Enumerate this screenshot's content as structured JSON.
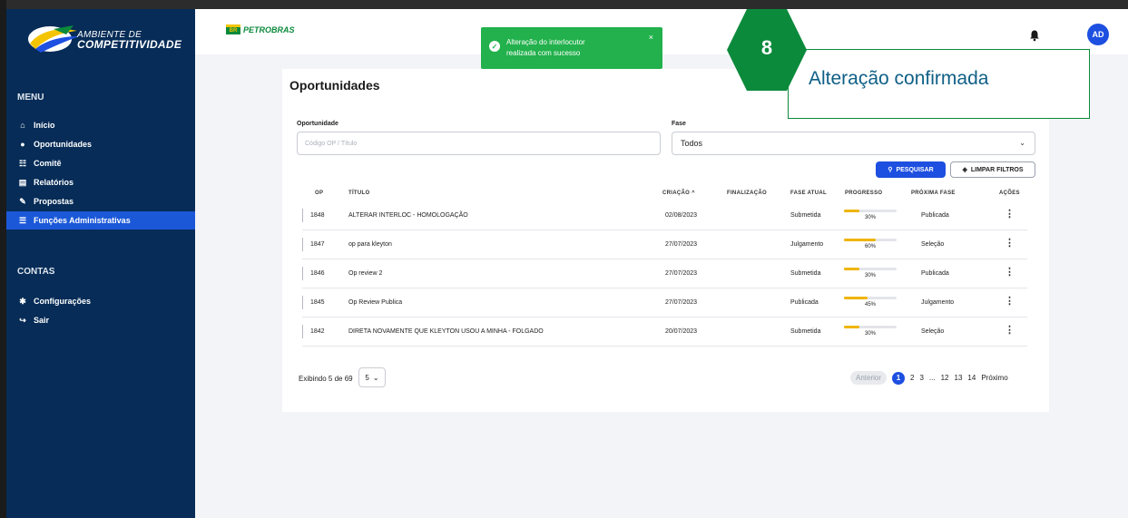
{
  "brand": {
    "line1": "AMBIENTE DE",
    "line2": "COMPETITIVIDADE"
  },
  "sidebar": {
    "menu_title": "MENU",
    "items": [
      {
        "icon": "home-icon",
        "glyph": "⌂",
        "label": "Início"
      },
      {
        "icon": "lightbulb-icon",
        "glyph": "●",
        "label": "Oportunidades"
      },
      {
        "icon": "committee-icon",
        "glyph": "☷",
        "label": "Comitê"
      },
      {
        "icon": "file-icon",
        "glyph": "▤",
        "label": "Relatórios"
      },
      {
        "icon": "proposal-icon",
        "glyph": "✎",
        "label": "Propostas"
      },
      {
        "icon": "list-icon",
        "glyph": "☰",
        "label": "Funções Administrativas",
        "active": true
      }
    ],
    "accounts_title": "CONTAS",
    "account_items": [
      {
        "icon": "gear-icon",
        "glyph": "✱",
        "label": "Configurações"
      },
      {
        "icon": "logout-icon",
        "glyph": "↪",
        "label": "Sair"
      }
    ]
  },
  "header": {
    "company": "PETROBRAS",
    "company_badge": "BR",
    "avatar": "AD"
  },
  "toast": {
    "message_line1": "Alteração do interlocutor",
    "message_line2": "realizada com sucesso",
    "close": "×"
  },
  "annotation": {
    "step": "8",
    "text": "Alteração confirmada"
  },
  "page": {
    "title": "Oportunidades",
    "filters": {
      "opportunity_label": "Oportunidade",
      "opportunity_placeholder": "Código OP / Título",
      "phase_label": "Fase",
      "phase_value": "Todos",
      "search_button": "PESQUISAR",
      "clear_button": "LIMPAR FILTROS"
    },
    "table": {
      "headers": [
        "OP",
        "TÍTULO",
        "CRIAÇÃO ^",
        "FINALIZAÇÃO",
        "FASE ATUAL",
        "PROGRESSO",
        "PRÓXIMA FASE",
        "AÇÕES"
      ],
      "rows": [
        {
          "op": "1848",
          "title": "ALTERAR INTERLOC - HOMOLOGAÇÃO",
          "created": "02/08/2023",
          "finished": "",
          "phase": "Submetida",
          "progress": 30,
          "progress_label": "30%",
          "next": "Publicada"
        },
        {
          "op": "1847",
          "title": "op para kleyton",
          "created": "27/07/2023",
          "finished": "",
          "phase": "Julgamento",
          "progress": 60,
          "progress_label": "60%",
          "next": "Seleção"
        },
        {
          "op": "1846",
          "title": "Op review 2",
          "created": "27/07/2023",
          "finished": "",
          "phase": "Submetida",
          "progress": 30,
          "progress_label": "30%",
          "next": "Publicada"
        },
        {
          "op": "1845",
          "title": "Op Review Publica",
          "created": "27/07/2023",
          "finished": "",
          "phase": "Publicada",
          "progress": 45,
          "progress_label": "45%",
          "next": "Julgamento"
        },
        {
          "op": "1842",
          "title": "DIRETA NOVAMENTE QUE KLEYTON USOU A MINHA - FOLGADO",
          "created": "20/07/2023",
          "finished": "",
          "phase": "Submetida",
          "progress": 30,
          "progress_label": "30%",
          "next": "Seleção"
        }
      ]
    },
    "footer": {
      "showing": "Exibindo 5 de 69",
      "page_size": "5",
      "pagination": {
        "prev": "Anterior",
        "pages": [
          "1",
          "2",
          "3",
          "...",
          "12",
          "13",
          "14"
        ],
        "current": "1",
        "next": "Próximo"
      }
    }
  },
  "colors": {
    "sidebar": "#062c57",
    "active": "#1b58d8",
    "primary": "#1d4fe0",
    "success": "#22b14c",
    "progress": "#f0b400",
    "petrobras_green": "#0b8a3b"
  }
}
